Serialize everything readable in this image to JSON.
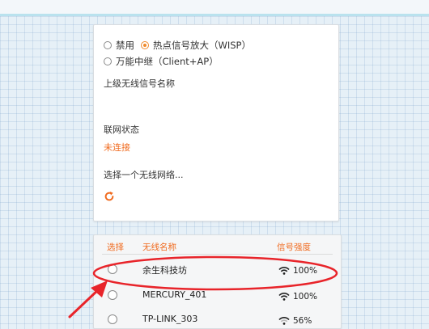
{
  "mode": {
    "options": [
      {
        "label": "禁用",
        "selected": false
      },
      {
        "label": "热点信号放大（WISP）",
        "selected": true
      },
      {
        "label": "万能中继（Client+AP）",
        "selected": false
      }
    ],
    "upper_ssid_label": "上级无线信号名称",
    "status_label": "联网状态",
    "status_value": "未连接",
    "choose_network_label": "选择一个无线网络..."
  },
  "network_list": {
    "headers": {
      "select": "选择",
      "name": "无线名称",
      "signal": "信号强度"
    },
    "rows": [
      {
        "name": "余生科技坊",
        "signal": "100%"
      },
      {
        "name": "MERCURY_401",
        "signal": "100%"
      },
      {
        "name": "TP-LINK_303",
        "signal": "56%"
      }
    ]
  },
  "colors": {
    "accent": "#f06a1e",
    "annotation": "#e8242a"
  },
  "icons": {
    "refresh": "refresh-icon",
    "wifi": "wifi-signal-icon"
  }
}
